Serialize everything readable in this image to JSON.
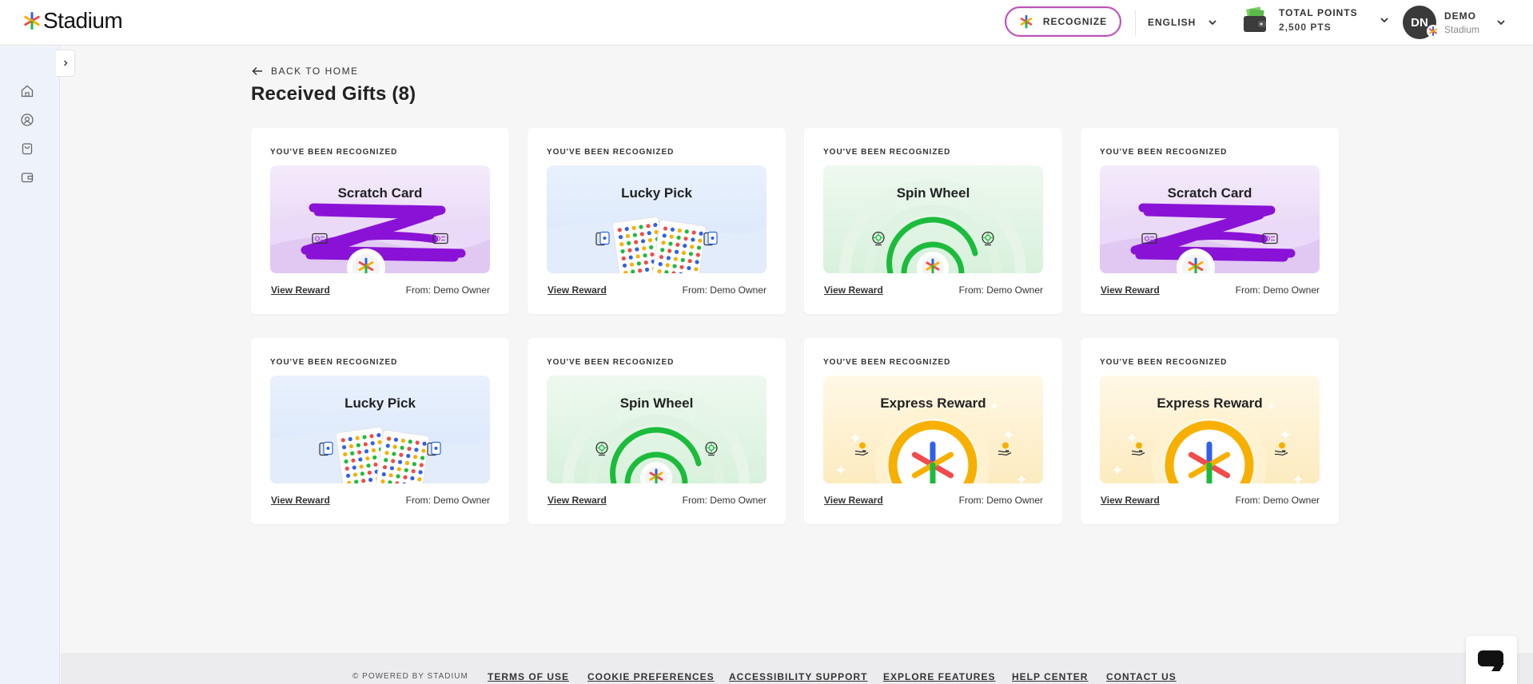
{
  "app": {
    "name": "Stadium"
  },
  "header": {
    "recognize_label": "RECOGNIZE",
    "language": "ENGLISH",
    "points_label": "TOTAL POINTS",
    "points_value": "2,500 PTS",
    "user_initials": "DN",
    "user_name": "DEMO",
    "user_org": "Stadium"
  },
  "sidebar": {
    "items": [
      {
        "icon": "home-icon"
      },
      {
        "icon": "recognition-icon"
      },
      {
        "icon": "shop-icon"
      },
      {
        "icon": "wallet-icon"
      }
    ]
  },
  "page": {
    "back_label": "BACK TO HOME",
    "title": "Received Gifts (8)"
  },
  "cards": [
    {
      "eyebrow": "YOU'VE BEEN RECOGNIZED",
      "type": "scratch",
      "title": "Scratch Card",
      "link": "View Reward",
      "from": "From: Demo Owner"
    },
    {
      "eyebrow": "YOU'VE BEEN RECOGNIZED",
      "type": "lucky",
      "title": "Lucky Pick",
      "link": "View Reward",
      "from": "From: Demo Owner"
    },
    {
      "eyebrow": "YOU'VE BEEN RECOGNIZED",
      "type": "spin",
      "title": "Spin Wheel",
      "link": "View Reward",
      "from": "From: Demo Owner"
    },
    {
      "eyebrow": "YOU'VE BEEN RECOGNIZED",
      "type": "scratch",
      "title": "Scratch Card",
      "link": "View Reward",
      "from": "From: Demo Owner"
    },
    {
      "eyebrow": "YOU'VE BEEN RECOGNIZED",
      "type": "lucky",
      "title": "Lucky Pick",
      "link": "View Reward",
      "from": "From: Demo Owner"
    },
    {
      "eyebrow": "YOU'VE BEEN RECOGNIZED",
      "type": "spin",
      "title": "Spin Wheel",
      "link": "View Reward",
      "from": "From: Demo Owner"
    },
    {
      "eyebrow": "YOU'VE BEEN RECOGNIZED",
      "type": "express",
      "title": "Express Reward",
      "link": "View Reward",
      "from": "From: Demo Owner"
    },
    {
      "eyebrow": "YOU'VE BEEN RECOGNIZED",
      "type": "express",
      "title": "Express Reward",
      "link": "View Reward",
      "from": "From: Demo Owner"
    }
  ],
  "footer": {
    "copyright": "© POWERED BY STADIUM",
    "links": [
      "TERMS OF USE",
      "COOKIE PREFERENCES",
      "ACCESSIBILITY SUPPORT",
      "EXPLORE FEATURES",
      "HELP CENTER",
      "CONTACT US"
    ]
  },
  "colors": {
    "accent": "#c04fb6",
    "scratch_stroke": "#8a12d6",
    "spin_ring": "#1cbb3c",
    "express_ring": "#f7b000"
  }
}
